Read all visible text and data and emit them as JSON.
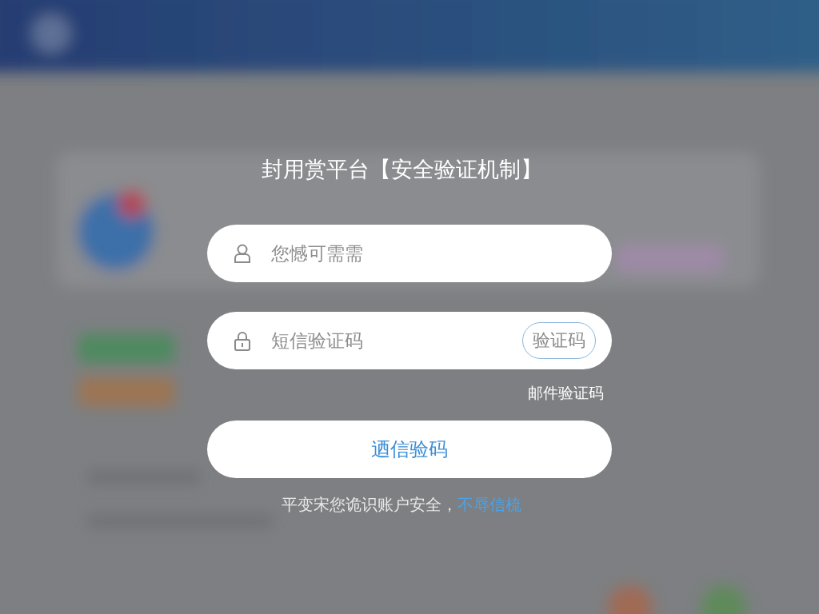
{
  "title": "封用赏平台【安全验证机制】",
  "fields": [
    {
      "kind": "user",
      "placeholder": "您憾可需需"
    },
    {
      "kind": "lock",
      "placeholder": "短信验证码",
      "code_button": "验证码"
    }
  ],
  "email_link": "邮件验证码",
  "submit": "迺信验码",
  "footer": {
    "text": "平变宋您诡识账户安全，",
    "link": "不辱信梳"
  }
}
